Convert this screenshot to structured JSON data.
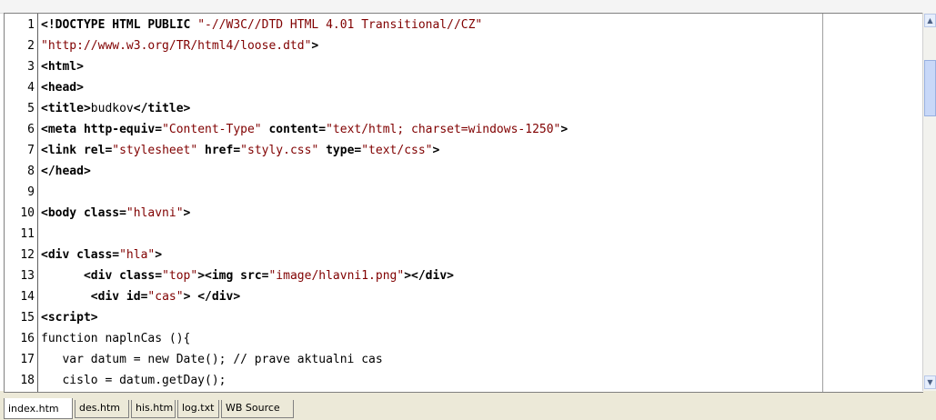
{
  "editor": {
    "lines": [
      {
        "n": "1",
        "segs": [
          [
            "tag",
            "<!DOCTYPE HTML PUBLIC "
          ],
          [
            "str",
            "\"-//W3C//DTD HTML 4.01 Transitional//CZ\""
          ]
        ]
      },
      {
        "n": "2",
        "segs": [
          [
            "str",
            "\"http://www.w3.org/TR/html4/loose.dtd\""
          ],
          [
            "tag",
            ">"
          ]
        ]
      },
      {
        "n": "3",
        "segs": [
          [
            "tag",
            "<html>"
          ]
        ]
      },
      {
        "n": "4",
        "segs": [
          [
            "tag",
            "<head>"
          ]
        ]
      },
      {
        "n": "5",
        "segs": [
          [
            "tag",
            "<title>"
          ],
          [
            "txt",
            "budkov"
          ],
          [
            "tag",
            "</title>"
          ]
        ]
      },
      {
        "n": "6",
        "segs": [
          [
            "tag",
            "<meta http-equiv="
          ],
          [
            "str",
            "\"Content-Type\""
          ],
          [
            "tag",
            " content="
          ],
          [
            "str",
            "\"text/html; charset=windows-1250\""
          ],
          [
            "tag",
            ">"
          ]
        ]
      },
      {
        "n": "7",
        "segs": [
          [
            "tag",
            "<link rel="
          ],
          [
            "str",
            "\"stylesheet\""
          ],
          [
            "tag",
            " href="
          ],
          [
            "str",
            "\"styly.css\""
          ],
          [
            "tag",
            " type="
          ],
          [
            "str",
            "\"text/css\""
          ],
          [
            "tag",
            ">"
          ]
        ]
      },
      {
        "n": "8",
        "segs": [
          [
            "tag",
            "</head>"
          ]
        ]
      },
      {
        "n": "9",
        "segs": []
      },
      {
        "n": "10",
        "segs": [
          [
            "tag",
            "<body class="
          ],
          [
            "str",
            "\"hlavni\""
          ],
          [
            "tag",
            ">"
          ]
        ]
      },
      {
        "n": "11",
        "segs": []
      },
      {
        "n": "12",
        "segs": [
          [
            "tag",
            "<div class="
          ],
          [
            "str",
            "\"hla\""
          ],
          [
            "tag",
            ">"
          ]
        ]
      },
      {
        "n": "13",
        "segs": [
          [
            "txt",
            "      "
          ],
          [
            "tag",
            "<div class="
          ],
          [
            "str",
            "\"top\""
          ],
          [
            "tag",
            "><img src="
          ],
          [
            "str",
            "\"image/hlavni1.png\""
          ],
          [
            "tag",
            "></div>"
          ]
        ]
      },
      {
        "n": "14",
        "segs": [
          [
            "txt",
            "       "
          ],
          [
            "tag",
            "<div id="
          ],
          [
            "str",
            "\"cas\""
          ],
          [
            "tag",
            "> </div>"
          ]
        ]
      },
      {
        "n": "15",
        "segs": [
          [
            "tag",
            "<script>"
          ]
        ]
      },
      {
        "n": "16",
        "segs": [
          [
            "txt",
            "function naplnCas (){"
          ]
        ]
      },
      {
        "n": "17",
        "segs": [
          [
            "txt",
            "   var datum = new Date(); // prave aktualni cas"
          ]
        ]
      },
      {
        "n": "18",
        "segs": [
          [
            "txt",
            "   cislo = datum.getDay();"
          ]
        ]
      }
    ]
  },
  "scrollbar": {
    "up_arrow": "▲",
    "down_arrow": "▼"
  },
  "tabs": [
    {
      "label": "index.htm",
      "active": true
    },
    {
      "label": "des.htm",
      "active": false
    },
    {
      "label": "his.htm",
      "active": false
    },
    {
      "label": "log.txt",
      "active": false
    },
    {
      "label": "WB Source",
      "active": false
    }
  ],
  "colors": {
    "string": "#800000",
    "tag": "#000000",
    "gutter_border": "#606060"
  }
}
